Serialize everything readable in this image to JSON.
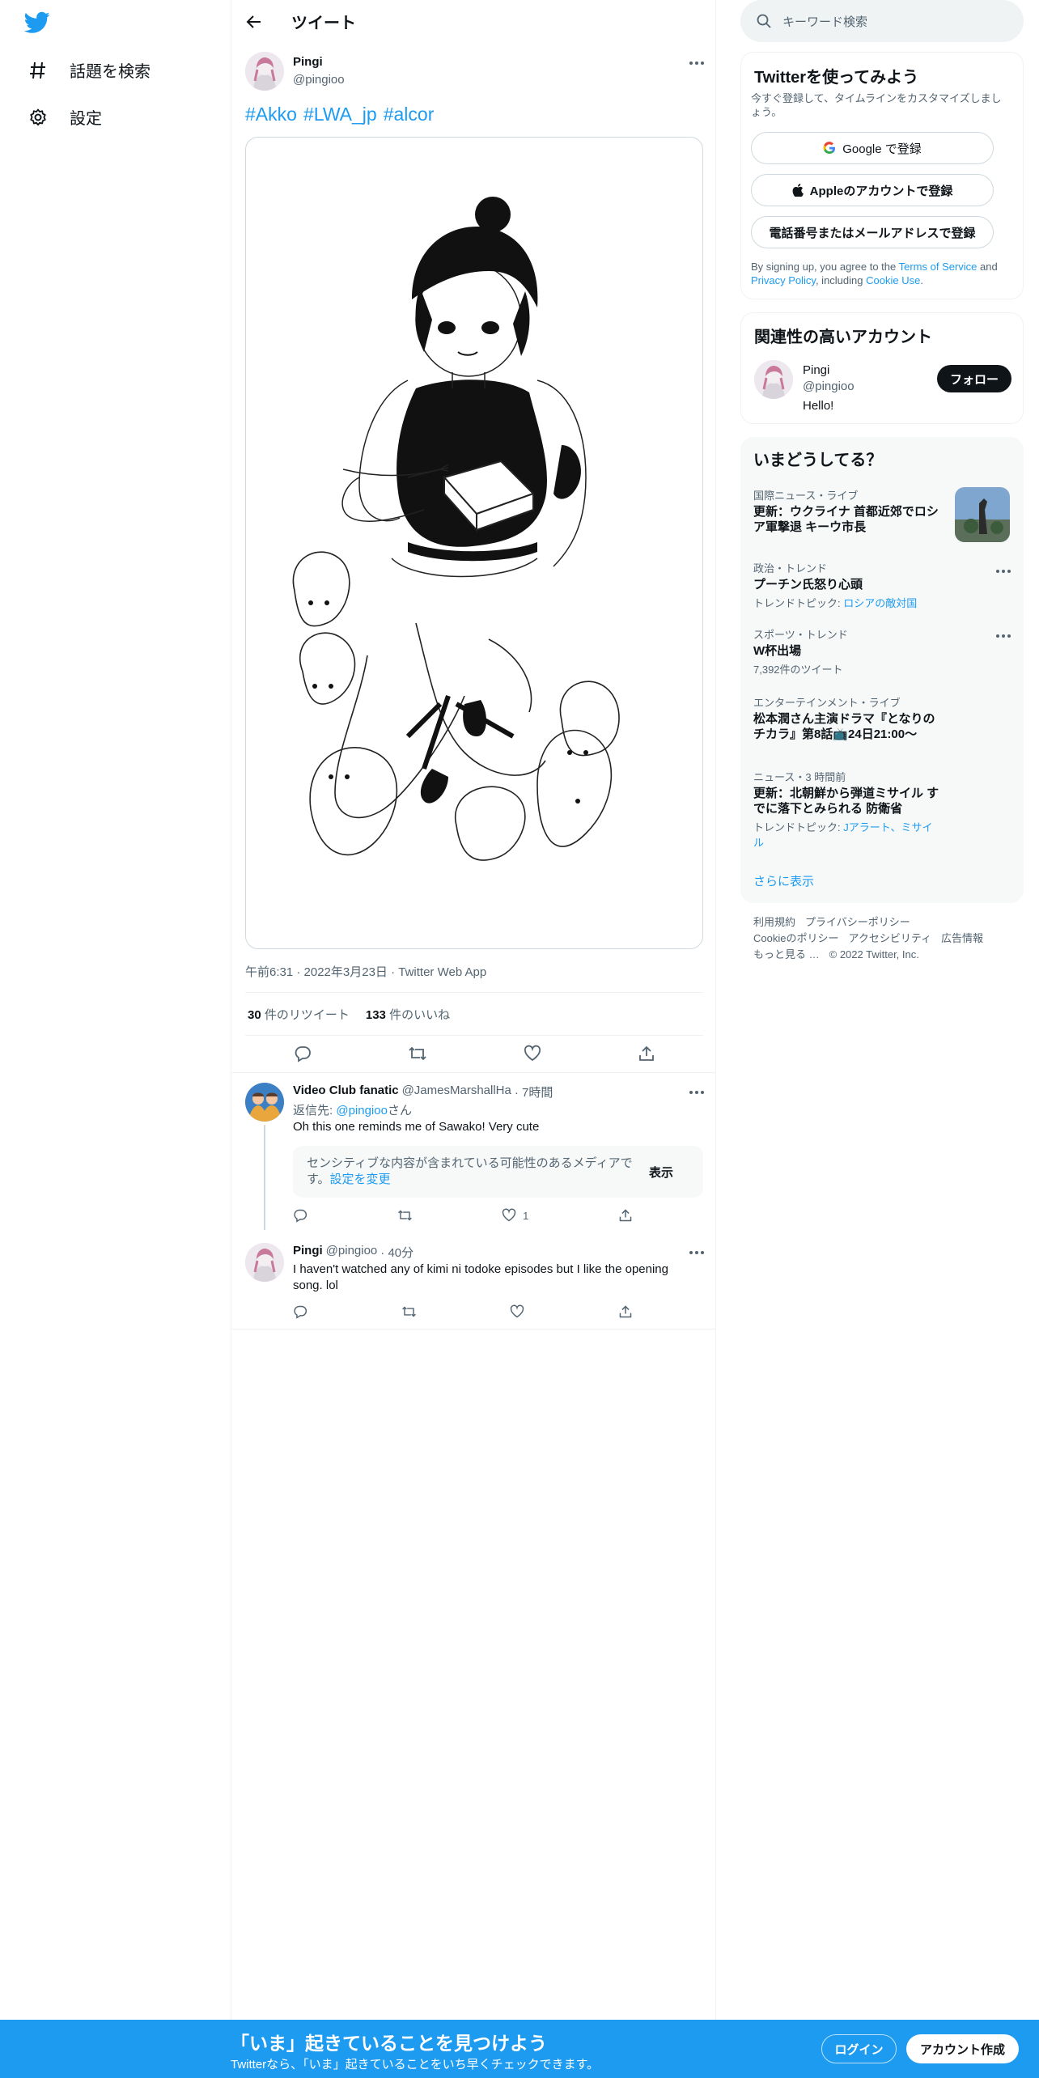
{
  "nav": {
    "explore_label": "話題を検索",
    "settings_label": "設定"
  },
  "header": {
    "title": "ツイート"
  },
  "tweet": {
    "author_name": "Pingi",
    "author_handle": "@pingioo",
    "hashtags": [
      "#Akko",
      "#LWA_jp",
      "#alcor"
    ],
    "meta": "午前6:31 · 2022年3月23日 · Twitter Web App",
    "retweets_count": "30",
    "retweets_label": "件のリツイート",
    "likes_count": "133",
    "likes_label": "件のいいね"
  },
  "replies": [
    {
      "name": "Video Club fanatic",
      "handle": "@JamesMarshallHa",
      "time": "· 7時間",
      "reply_to_prefix": "返信先: ",
      "reply_to_handle": "@pingioo",
      "reply_to_suffix": "さん",
      "text": "Oh this one reminds me of Sawako! Very cute",
      "sensitive_text": "センシティブな内容が含まれている可能性のあるメディアです。",
      "sensitive_link": "設定を変更",
      "sensitive_button": "表示",
      "like_count": "1"
    },
    {
      "name": "Pingi",
      "handle": "@pingioo",
      "time": "· 40分",
      "text": "I haven't  watched any of kimi ni todoke episodes but I like the opening song. lol"
    }
  ],
  "search": {
    "placeholder": "キーワード検索"
  },
  "signup": {
    "title": "Twitterを使ってみよう",
    "subtitle": "今すぐ登録して、タイムラインをカスタマイズしましょう。",
    "google_button": "Google で登録",
    "apple_button": "Appleのアカウントで登録",
    "phone_button": "電話番号またはメールアドレスで登録",
    "legal_prefix": "By signing up, you agree to the ",
    "terms": "Terms of Service",
    "and": " and ",
    "privacy": "Privacy Policy",
    "including": ", including ",
    "cookie": "Cookie Use",
    "period": "."
  },
  "related": {
    "title": "関連性の高いアカウント",
    "name": "Pingi",
    "handle": "@pingioo",
    "bio": "Hello!",
    "follow_button": "フォロー"
  },
  "trends": {
    "title": "いまどうしてる？",
    "items": [
      {
        "category": "国際ニュース・ライブ",
        "title": "更新：ウクライナ 首都近郊でロシア軍撃退 キーウ市長"
      },
      {
        "category": "政治・トレンド",
        "title": "プーチン氏怒り心頭",
        "sub_prefix": "トレンドトピック: ",
        "sub_link": "ロシアの敵対国"
      },
      {
        "category": "スポーツ・トレンド",
        "title": "W杯出場",
        "sub": "7,392件のツイート"
      },
      {
        "category": "エンターテインメント・ライブ",
        "title": "松本潤さん主演ドラマ『となりのチカラ』第8話📺24日21:00〜"
      },
      {
        "category": "ニュース・3 時間前",
        "title": "更新：北朝鮮から弾道ミサイル すでに落下とみられる 防衛省",
        "sub_prefix": "トレンドトピック: ",
        "sub_link": "Jアラート、ミサイル"
      }
    ],
    "show_more": "さらに表示"
  },
  "footer": {
    "terms": "利用規約",
    "privacy": "プライバシーポリシー",
    "cookie": "Cookieのポリシー",
    "accessibility": "アクセシビリティ",
    "ads": "広告情報",
    "more": "もっと見る …",
    "copyright": "© 2022 Twitter, Inc."
  },
  "bottom_bar": {
    "title": "「いま」起きていることを見つけよう",
    "subtitle": "Twitterなら、「いま」起きていることをいち早くチェックできます。",
    "login": "ログイン",
    "signup": "アカウント作成"
  },
  "colors": {
    "accent": "#1d9bf0",
    "text": "#0f1419",
    "muted": "#536471"
  }
}
